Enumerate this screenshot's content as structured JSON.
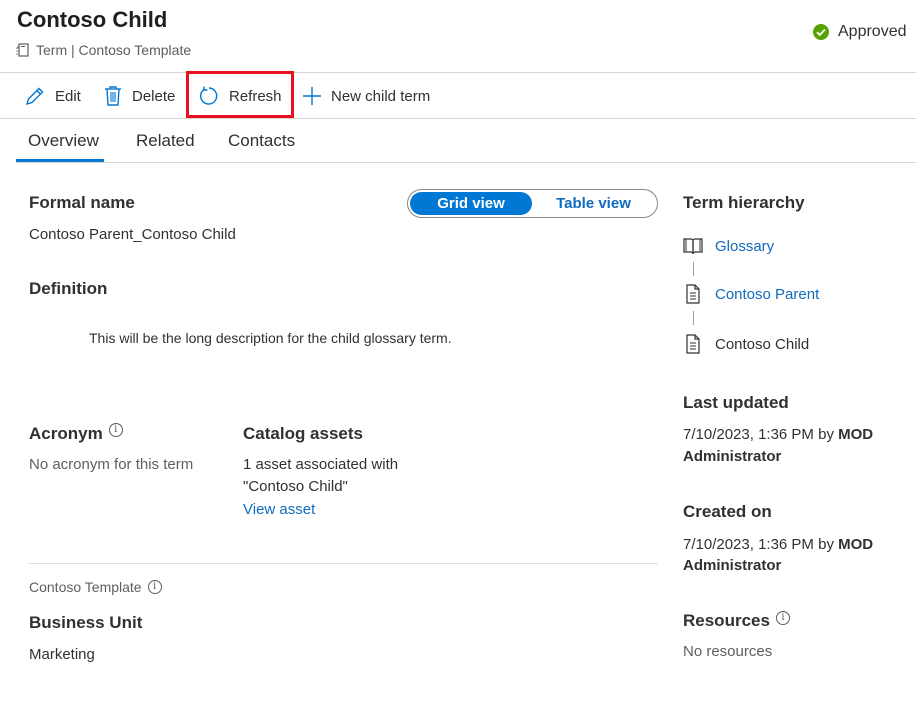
{
  "header": {
    "title": "Contoso Child",
    "subtitle": "Term | Contoso Template",
    "status": "Approved",
    "status_color": "#57a300"
  },
  "toolbar": {
    "edit": "Edit",
    "delete": "Delete",
    "refresh": "Refresh",
    "new_child_term": "New child term"
  },
  "tabs": [
    {
      "label": "Overview",
      "active": true
    },
    {
      "label": "Related",
      "active": false
    },
    {
      "label": "Contacts",
      "active": false
    }
  ],
  "view_toggle": {
    "grid": "Grid view",
    "table": "Table view",
    "selected": "Grid view"
  },
  "overview": {
    "formal_name_label": "Formal name",
    "formal_name_value": "Contoso Parent_Contoso Child",
    "definition_label": "Definition",
    "definition_value": "This will be the long description for the child glossary term.",
    "acronym_label": "Acronym",
    "acronym_value": "No acronym for this term",
    "catalog_assets_label": "Catalog assets",
    "catalog_assets_line1": "1 asset associated with",
    "catalog_assets_line2": "\"Contoso Child\"",
    "view_asset_link": "View asset",
    "template_name": "Contoso Template",
    "business_unit_label": "Business Unit",
    "business_unit_value": "Marketing"
  },
  "sidebar": {
    "hierarchy_label": "Term hierarchy",
    "hierarchy": [
      {
        "label": "Glossary",
        "icon": "book-icon",
        "link": true
      },
      {
        "label": "Contoso Parent",
        "icon": "document-icon",
        "link": true
      },
      {
        "label": "Contoso Child",
        "icon": "document-icon",
        "link": false
      }
    ],
    "last_updated_label": "Last updated",
    "last_updated_date": "7/10/2023, 1:36 PM by",
    "last_updated_by_1": "MOD",
    "last_updated_by_2": "Administrator",
    "created_on_label": "Created on",
    "created_on_date": "7/10/2023, 1:36 PM by",
    "created_by_1": "MOD",
    "created_by_2": "Administrator",
    "resources_label": "Resources",
    "resources_value": "No resources"
  },
  "colors": {
    "accent": "#0078d4",
    "link": "#0f6cbd",
    "highlight_box": "#e81123"
  }
}
